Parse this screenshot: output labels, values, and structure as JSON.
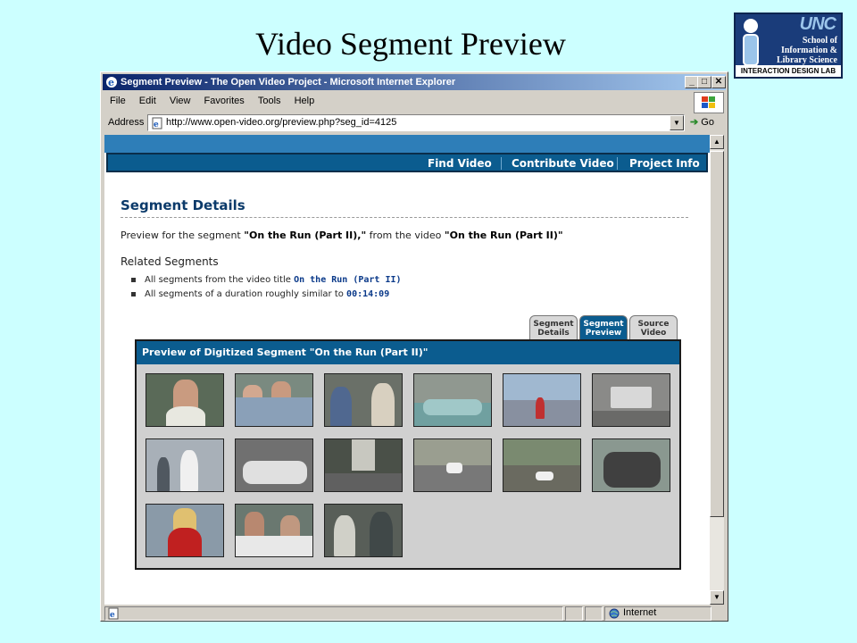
{
  "slide": {
    "title": "Video Segment Preview"
  },
  "logo": {
    "unc": "UNC",
    "line1": "School of",
    "line2": "Information &",
    "line3": "Library Science",
    "lab": "INTERACTION DESIGN LAB"
  },
  "browser": {
    "title": "Segment Preview - The Open Video Project - Microsoft Internet Explorer",
    "menu": [
      "File",
      "Edit",
      "View",
      "Favorites",
      "Tools",
      "Help"
    ],
    "address_label": "Address",
    "url": "http://www.open-video.org/preview.php?seg_id=4125",
    "go_label": "Go",
    "status_zone": "Internet",
    "min_glyph": "_",
    "max_glyph": "□",
    "close_glyph": "✕"
  },
  "site": {
    "nav": [
      "Find Video",
      "Contribute Video",
      "Project Info"
    ]
  },
  "segment": {
    "heading": "Segment Details",
    "preview_prefix": "Preview for the segment ",
    "segment_name": "\"On the Run (Part II),\"",
    "preview_middle": " from the video ",
    "video_name": "\"On the Run (Part II)\"",
    "related_heading": "Related Segments",
    "related_1_text": "All segments from the video title ",
    "related_1_link": "On the Run (Part II)",
    "related_2_text": "All segments of a duration roughly similar to ",
    "related_2_link": "00:14:09"
  },
  "tabs": [
    {
      "line1": "Segment",
      "line2": "Details"
    },
    {
      "line1": "Segment",
      "line2": "Preview"
    },
    {
      "line1": "Source",
      "line2": "Video"
    }
  ],
  "preview": {
    "header": "Preview of Digitized Segment \"On the Run (Part II)\""
  }
}
